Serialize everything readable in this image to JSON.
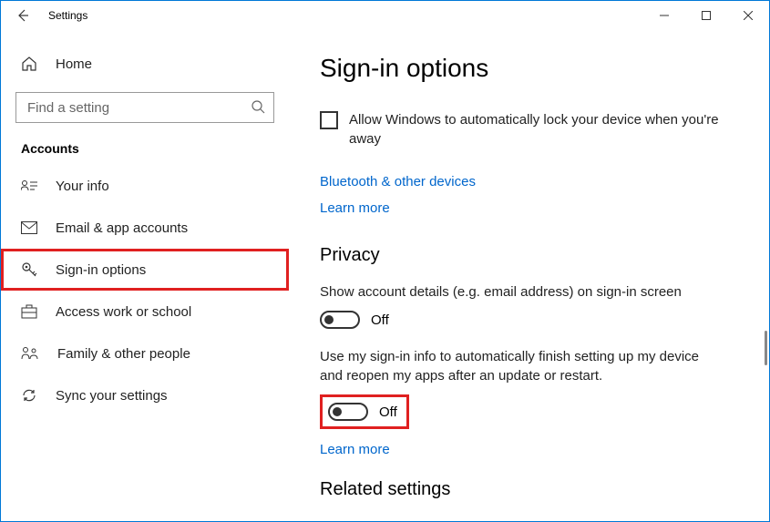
{
  "window": {
    "title": "Settings"
  },
  "sidebar": {
    "home_label": "Home",
    "search_placeholder": "Find a setting",
    "section_title": "Accounts",
    "items": [
      {
        "label": "Your info"
      },
      {
        "label": "Email & app accounts"
      },
      {
        "label": "Sign-in options"
      },
      {
        "label": "Access work or school"
      },
      {
        "label": "Family & other people"
      },
      {
        "label": "Sync your settings"
      }
    ]
  },
  "main": {
    "title": "Sign-in options",
    "autolock_label": "Allow Windows to automatically lock your device when you're away",
    "link_bluetooth": "Bluetooth & other devices",
    "link_learn_more": "Learn more",
    "privacy_heading": "Privacy",
    "privacy_setting1": "Show account details (e.g. email address) on sign-in screen",
    "privacy_toggle1": "Off",
    "privacy_setting2": "Use my sign-in info to automatically finish setting up my device and reopen my apps after an update or restart.",
    "privacy_toggle2": "Off",
    "related_heading": "Related settings"
  }
}
